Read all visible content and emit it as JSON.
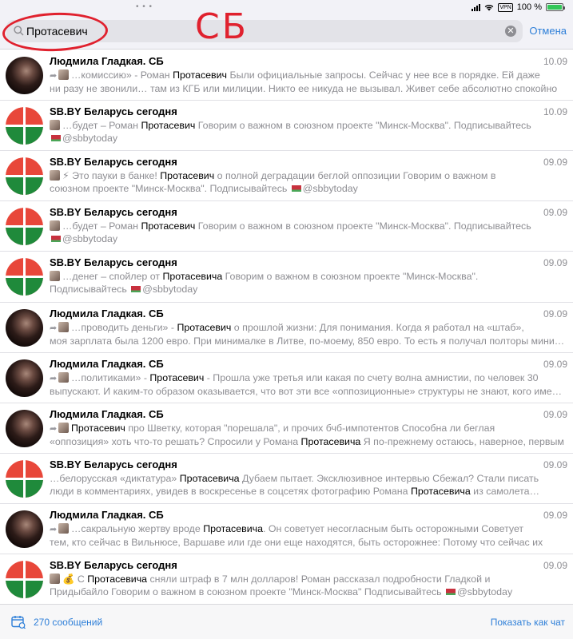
{
  "status": {
    "battery": "100 %",
    "battery_level": 1.0,
    "vpn": "VPN"
  },
  "search": {
    "query": "Протасевич",
    "cancel": "Отмена"
  },
  "annotation": {
    "text": "СБ"
  },
  "colors": {
    "accent": "#2e7fd8",
    "annotation": "#e0212e",
    "sb_red": "#e8473a",
    "sb_green": "#1f8a3b"
  },
  "rows": [
    {
      "avatar": "photo",
      "title": "Людмила Гладкая. СБ",
      "date": "10.09",
      "thumb": true,
      "fwd": true,
      "l1": [
        [
          "…комиссию» - Роман ",
          false
        ],
        [
          "Протасевич",
          true
        ],
        [
          " Были официальные запросы. Сейчас у нее все в порядке. Ей даже",
          false
        ]
      ],
      "l2": [
        [
          "ни разу не звонили… там из КГБ или милиции. Никто ее никуда не вызывал.  Живет себе абсолютно спокойно",
          false
        ]
      ]
    },
    {
      "avatar": "sb",
      "title": "SB.BY Беларусь сегодня",
      "date": "10.09",
      "thumb": true,
      "fwd": false,
      "l1": [
        [
          "…будет – Роман ",
          false
        ],
        [
          "Протасевич",
          true
        ],
        [
          " Говорим о важном в союзном проекте \"Минск-Москва\".  Подписывайтесь",
          false
        ]
      ],
      "l2": [
        [
          "@sbbytoday",
          false
        ]
      ],
      "flag2": true
    },
    {
      "avatar": "sb",
      "title": "SB.BY Беларусь сегодня",
      "date": "09.09",
      "thumb": true,
      "fwd": false,
      "l1": [
        [
          "⚡ Это пауки в банке! ",
          false
        ],
        [
          "Протасевич",
          true
        ],
        [
          " о полной деградации беглой оппозиции Говорим о важном в",
          false
        ]
      ],
      "l2": [
        [
          "союзном проекте \"Минск-Москва\".  Подписывайтесь ",
          false
        ],
        [
          "@sbbytoday",
          false
        ]
      ],
      "flag2mid": true
    },
    {
      "avatar": "sb",
      "title": "SB.BY Беларусь сегодня",
      "date": "09.09",
      "thumb": true,
      "fwd": false,
      "l1": [
        [
          "…будет – Роман ",
          false
        ],
        [
          "Протасевич",
          true
        ],
        [
          " Говорим о важном в союзном проекте \"Минск-Москва\".  Подписывайтесь",
          false
        ]
      ],
      "l2": [
        [
          "@sbbytoday",
          false
        ]
      ],
      "flag2": true
    },
    {
      "avatar": "sb",
      "title": "SB.BY Беларусь сегодня",
      "date": "09.09",
      "thumb": true,
      "fwd": false,
      "l1": [
        [
          "…денег – спойлер от ",
          false
        ],
        [
          "Протасевича",
          true
        ],
        [
          " Говорим о важном в союзном проекте \"Минск-Москва\".",
          false
        ]
      ],
      "l2": [
        [
          "Подписывайтесь ",
          false
        ],
        [
          "@sbbytoday",
          false
        ]
      ],
      "flag2mid": true
    },
    {
      "avatar": "photo",
      "title": "Людмила Гладкая. СБ",
      "date": "09.09",
      "thumb": true,
      "fwd": true,
      "l1": [
        [
          "…проводить деньги» - ",
          false
        ],
        [
          "Протасевич",
          true
        ],
        [
          " о прошлой жизни: Для понимания. Когда я работал на «штаб»,",
          false
        ]
      ],
      "l2": [
        [
          "моя зарплата была 1200 евро. При минималке в Литве, по-моему, 850 евро. То есть я получал полторы минималки",
          false
        ]
      ]
    },
    {
      "avatar": "photo",
      "title": "Людмила Гладкая. СБ",
      "date": "09.09",
      "thumb": true,
      "fwd": true,
      "l1": [
        [
          "…политиками» - ",
          false
        ],
        [
          "Протасевич",
          true
        ],
        [
          " - Прошла уже третья или какая по счету волна амнистии, по человек 30",
          false
        ]
      ],
      "l2": [
        [
          "выпускают. И каким-то образом оказывается, что вот эти все «оппозиционные» структуры не знают, кого именно",
          false
        ]
      ]
    },
    {
      "avatar": "photo",
      "title": "Людмила Гладкая. СБ",
      "date": "09.09",
      "thumb": true,
      "fwd": true,
      "l1": [
        [
          "Протасевич",
          true
        ],
        [
          " про Шветку, которая \"порешала\", и прочих бчб-импотентов Способна ли беглая",
          false
        ]
      ],
      "l2": [
        [
          "«оппозиция» хоть что-то решать? Спросили у Романа ",
          false
        ],
        [
          "Протасевича",
          true
        ],
        [
          " Я по-прежнему остаюсь, наверное, первым",
          false
        ]
      ]
    },
    {
      "avatar": "sb",
      "title": "SB.BY Беларусь сегодня",
      "date": "09.09",
      "thumb": false,
      "fwd": false,
      "l1": [
        [
          "…белорусская «диктатура» ",
          false
        ],
        [
          "Протасевича",
          true
        ],
        [
          " Дубаем пытает. Эксклюзивное интервью Сбежал? Стали писать",
          false
        ]
      ],
      "l2": [
        [
          "люди в комментариях, увидев в воскресенье в соцсетях фотографию Романа ",
          false
        ],
        [
          "Протасевича",
          true
        ],
        [
          " из самолета…",
          false
        ]
      ]
    },
    {
      "avatar": "photo",
      "title": "Людмила Гладкая. СБ",
      "date": "09.09",
      "thumb": true,
      "fwd": true,
      "l1": [
        [
          "…сакральную жертву вроде ",
          false
        ],
        [
          "Протасевича",
          true
        ],
        [
          ". Он советует несогласным быть осторожными Советует",
          false
        ]
      ],
      "l2": [
        [
          "тем, кто сейчас в Вильнюсе, Варшаве или где они еще находятся, быть осторожнее: Потому что сейчас их",
          false
        ]
      ]
    },
    {
      "avatar": "sb",
      "title": "SB.BY Беларусь сегодня",
      "date": "09.09",
      "thumb": true,
      "fwd": false,
      "l1": [
        [
          "💰 С ",
          false
        ],
        [
          "Протасевича",
          true
        ],
        [
          " сняли штраф в 7 млн долларов! Роман рассказал подробности Гладкой и",
          false
        ]
      ],
      "l2": [
        [
          "Придыбайло Говорим о важном в союзном проекте \"Минск-Москва\" Подписывайтесь ",
          false
        ],
        [
          "@sbbytoday",
          false
        ]
      ],
      "flag2mid": true
    }
  ],
  "footer": {
    "count": "270 сообщений",
    "show_as_chat": "Показать как чат"
  }
}
